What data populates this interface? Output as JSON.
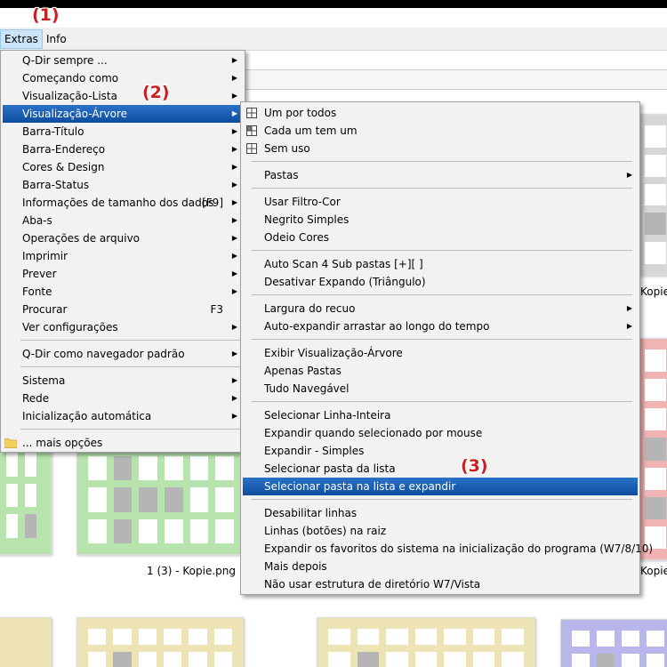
{
  "callouts": [
    "(1)",
    "(2)",
    "(3)"
  ],
  "menubar": {
    "items": [
      "Extras",
      "Info"
    ]
  },
  "captions": {
    "kopie_right_1": "Kopie",
    "middle": "1 (3) - Kopie.png",
    "kopie_right_2": "Kopie"
  },
  "extras_menu": {
    "items": [
      {
        "label": "Q-Dir sempre ...",
        "arrow": true
      },
      {
        "label": "Começando como",
        "arrow": true
      },
      {
        "label": "Visualização-Lista",
        "arrow": true
      },
      {
        "label": "Visualização-Árvore",
        "arrow": true,
        "highlight": true
      },
      {
        "label": "Barra-Título",
        "arrow": true
      },
      {
        "label": "Barra-Endereço",
        "arrow": true
      },
      {
        "label": "Cores & Design",
        "arrow": true
      },
      {
        "label": "Barra-Status",
        "arrow": true
      },
      {
        "label": "Informações de tamanho dos dados",
        "shortcut": "[F9]",
        "arrow": true
      },
      {
        "label": "Aba-s",
        "arrow": true
      },
      {
        "label": "Operações de arquivo",
        "arrow": true
      },
      {
        "label": "Imprimir",
        "arrow": true
      },
      {
        "label": "Prever",
        "arrow": true
      },
      {
        "label": "Fonte",
        "arrow": true
      },
      {
        "label": "Procurar",
        "shortcut": "F3",
        "arrow": true
      },
      {
        "label": "Ver configurações",
        "arrow": true
      },
      {
        "label": "Q-Dir como navegador padrão",
        "arrow": true
      },
      {
        "label": "Sistema",
        "arrow": true
      },
      {
        "label": "Rede",
        "arrow": true
      },
      {
        "label": "Inicialização automática",
        "arrow": true
      },
      {
        "label": "... mais opções",
        "icon": "folder-icon"
      }
    ]
  },
  "tree_submenu": {
    "items": [
      {
        "label": "Um por todos",
        "icon": "grid-icon"
      },
      {
        "label": "Cada um tem um",
        "icon": "grid-icon"
      },
      {
        "label": "Sem uso",
        "icon": "grid-icon"
      },
      {
        "label": "Pastas",
        "arrow": true
      },
      {
        "label": "Usar Filtro-Cor"
      },
      {
        "label": "Negrito Simples"
      },
      {
        "label": "Odeio Cores"
      },
      {
        "label": "Auto Scan 4 Sub pastas [+][ ]"
      },
      {
        "label": "Desativar Expando (Triângulo)"
      },
      {
        "label": "Largura do recuo",
        "arrow": true
      },
      {
        "label": "Auto-expandir arrastar ao longo do tempo",
        "arrow": true
      },
      {
        "label": "Exibir Visualização-Árvore"
      },
      {
        "label": "Apenas Pastas"
      },
      {
        "label": "Tudo Navegável"
      },
      {
        "label": "Selecionar Linha-Inteira"
      },
      {
        "label": "Expandir quando selecionado por mouse"
      },
      {
        "label": "Expandir - Simples"
      },
      {
        "label": "Selecionar pasta da lista"
      },
      {
        "label": "Selecionar pasta na lista e expandir",
        "highlight": true
      },
      {
        "label": "Desabilitar linhas"
      },
      {
        "label": "Linhas (botões) na raiz"
      },
      {
        "label": "Expandir os favoritos do sistema na inicialização do programa (W7/8/10)"
      },
      {
        "label": "Mais depois"
      },
      {
        "label": "Não usar estrutura de diretório W7/Vista"
      }
    ]
  },
  "colors": {
    "highlight": "#1a5fb4",
    "callout": "#c82020",
    "thumb_green": "#b7e3ad",
    "thumb_gray": "#d6d6d6",
    "thumb_red": "#f0b4b4",
    "thumb_yellow": "#ede3b5",
    "thumb_purple": "#b8b6ea"
  }
}
